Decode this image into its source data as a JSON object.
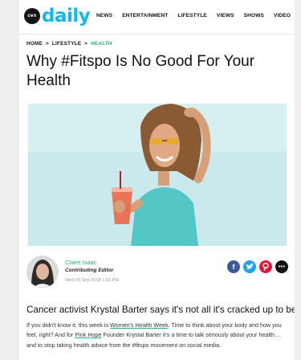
{
  "logo": {
    "badge": "cen",
    "word": "daily"
  },
  "nav": [
    "NEWS",
    "ENTERTAINMENT",
    "LIFESTYLE",
    "VIEWS",
    "SHOWS",
    "VIDEO"
  ],
  "breadcrumb": {
    "home": "HOME",
    "section": "LIFESTYLE",
    "current": "HEALTH",
    "separator": ">"
  },
  "article": {
    "title": "Why #Fitspo Is No Good For Your Health",
    "subheading": "Cancer activist Krystal Barter says it's not all it's cracked up to be.",
    "body": {
      "t1": "If you didn't know it, this week is ",
      "link1": "Women's Health Week",
      "t2": ". Time to think about your body and how you feel, right? And for ",
      "link2": "Pink Hope",
      "t3": " Founder Krystal Barter it's a time to talk seriously about your health… and to stop taking health advice from the #fitspo movement on social media."
    }
  },
  "author": {
    "name": "Claire Isaac",
    "role": "Contributing Editor",
    "date": "Wed 05 Sep 2018 1:51 PM"
  },
  "share": {
    "facebook": "f",
    "more": "•••"
  },
  "colors": {
    "brand": "#14b8e6",
    "accent_green": "#22b573",
    "facebook": "#3b5998",
    "twitter": "#1da1f2",
    "pinterest": "#e4163a",
    "hero_backdrop": "#c9e9ec"
  }
}
